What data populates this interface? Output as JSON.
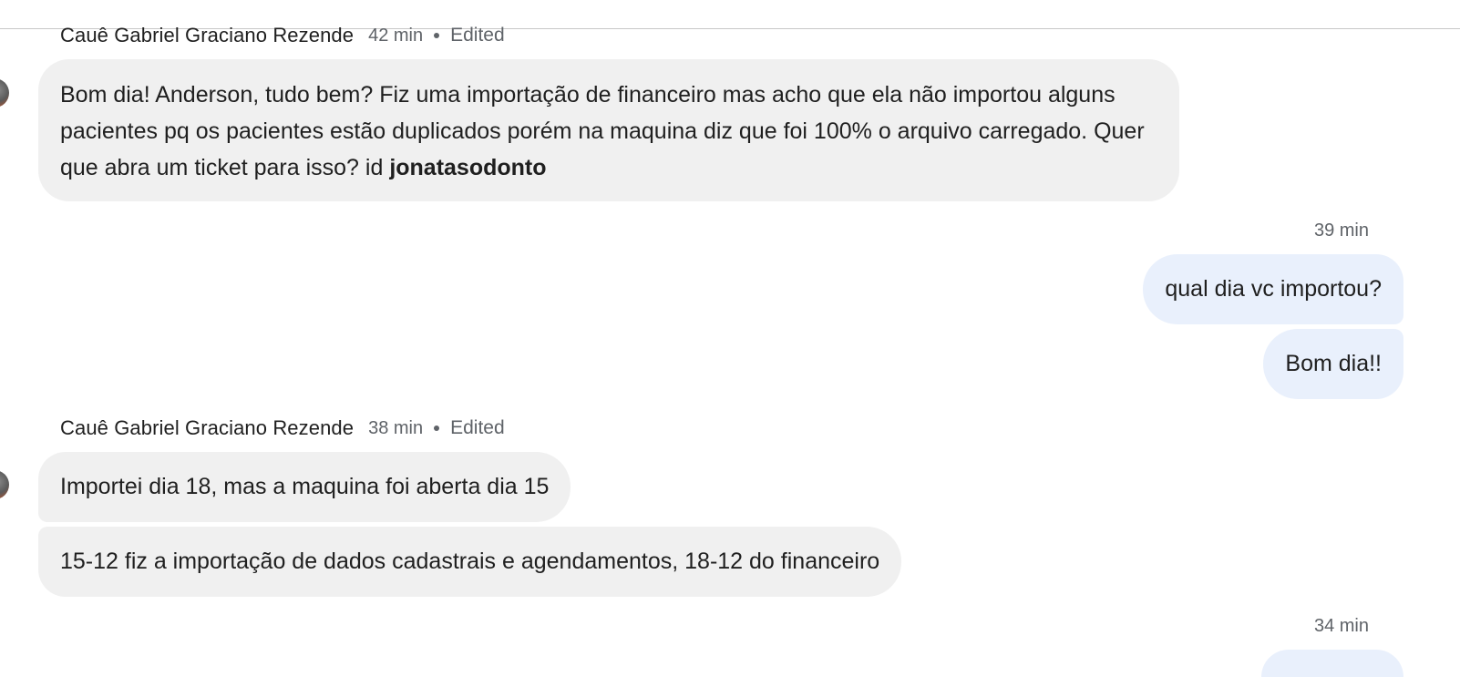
{
  "messages": [
    {
      "sender": "Cauê Gabriel Graciano Rezende",
      "time": "42 min",
      "edited": "Edited",
      "text_before": "Bom dia! Anderson,  tudo bem? Fiz uma importação de financeiro mas acho que ela não importou alguns pacientes pq os pacientes estão duplicados porém na maquina diz que foi 100% o arquivo carregado. Quer que abra um ticket para isso? id ",
      "text_bold": "jonatasodonto"
    },
    {
      "time": "39 min",
      "bubbles": [
        "qual dia vc importou?",
        "Bom dia!!"
      ]
    },
    {
      "sender": "Cauê Gabriel Graciano Rezende",
      "time": "38 min",
      "edited": "Edited",
      "bubbles": [
        "Importei dia 18, mas a maquina foi aberta dia 15",
        "15-12 fiz a importação de dados cadastrais e agendamentos, 18-12 do financeiro"
      ]
    },
    {
      "time": "34 min"
    }
  ]
}
